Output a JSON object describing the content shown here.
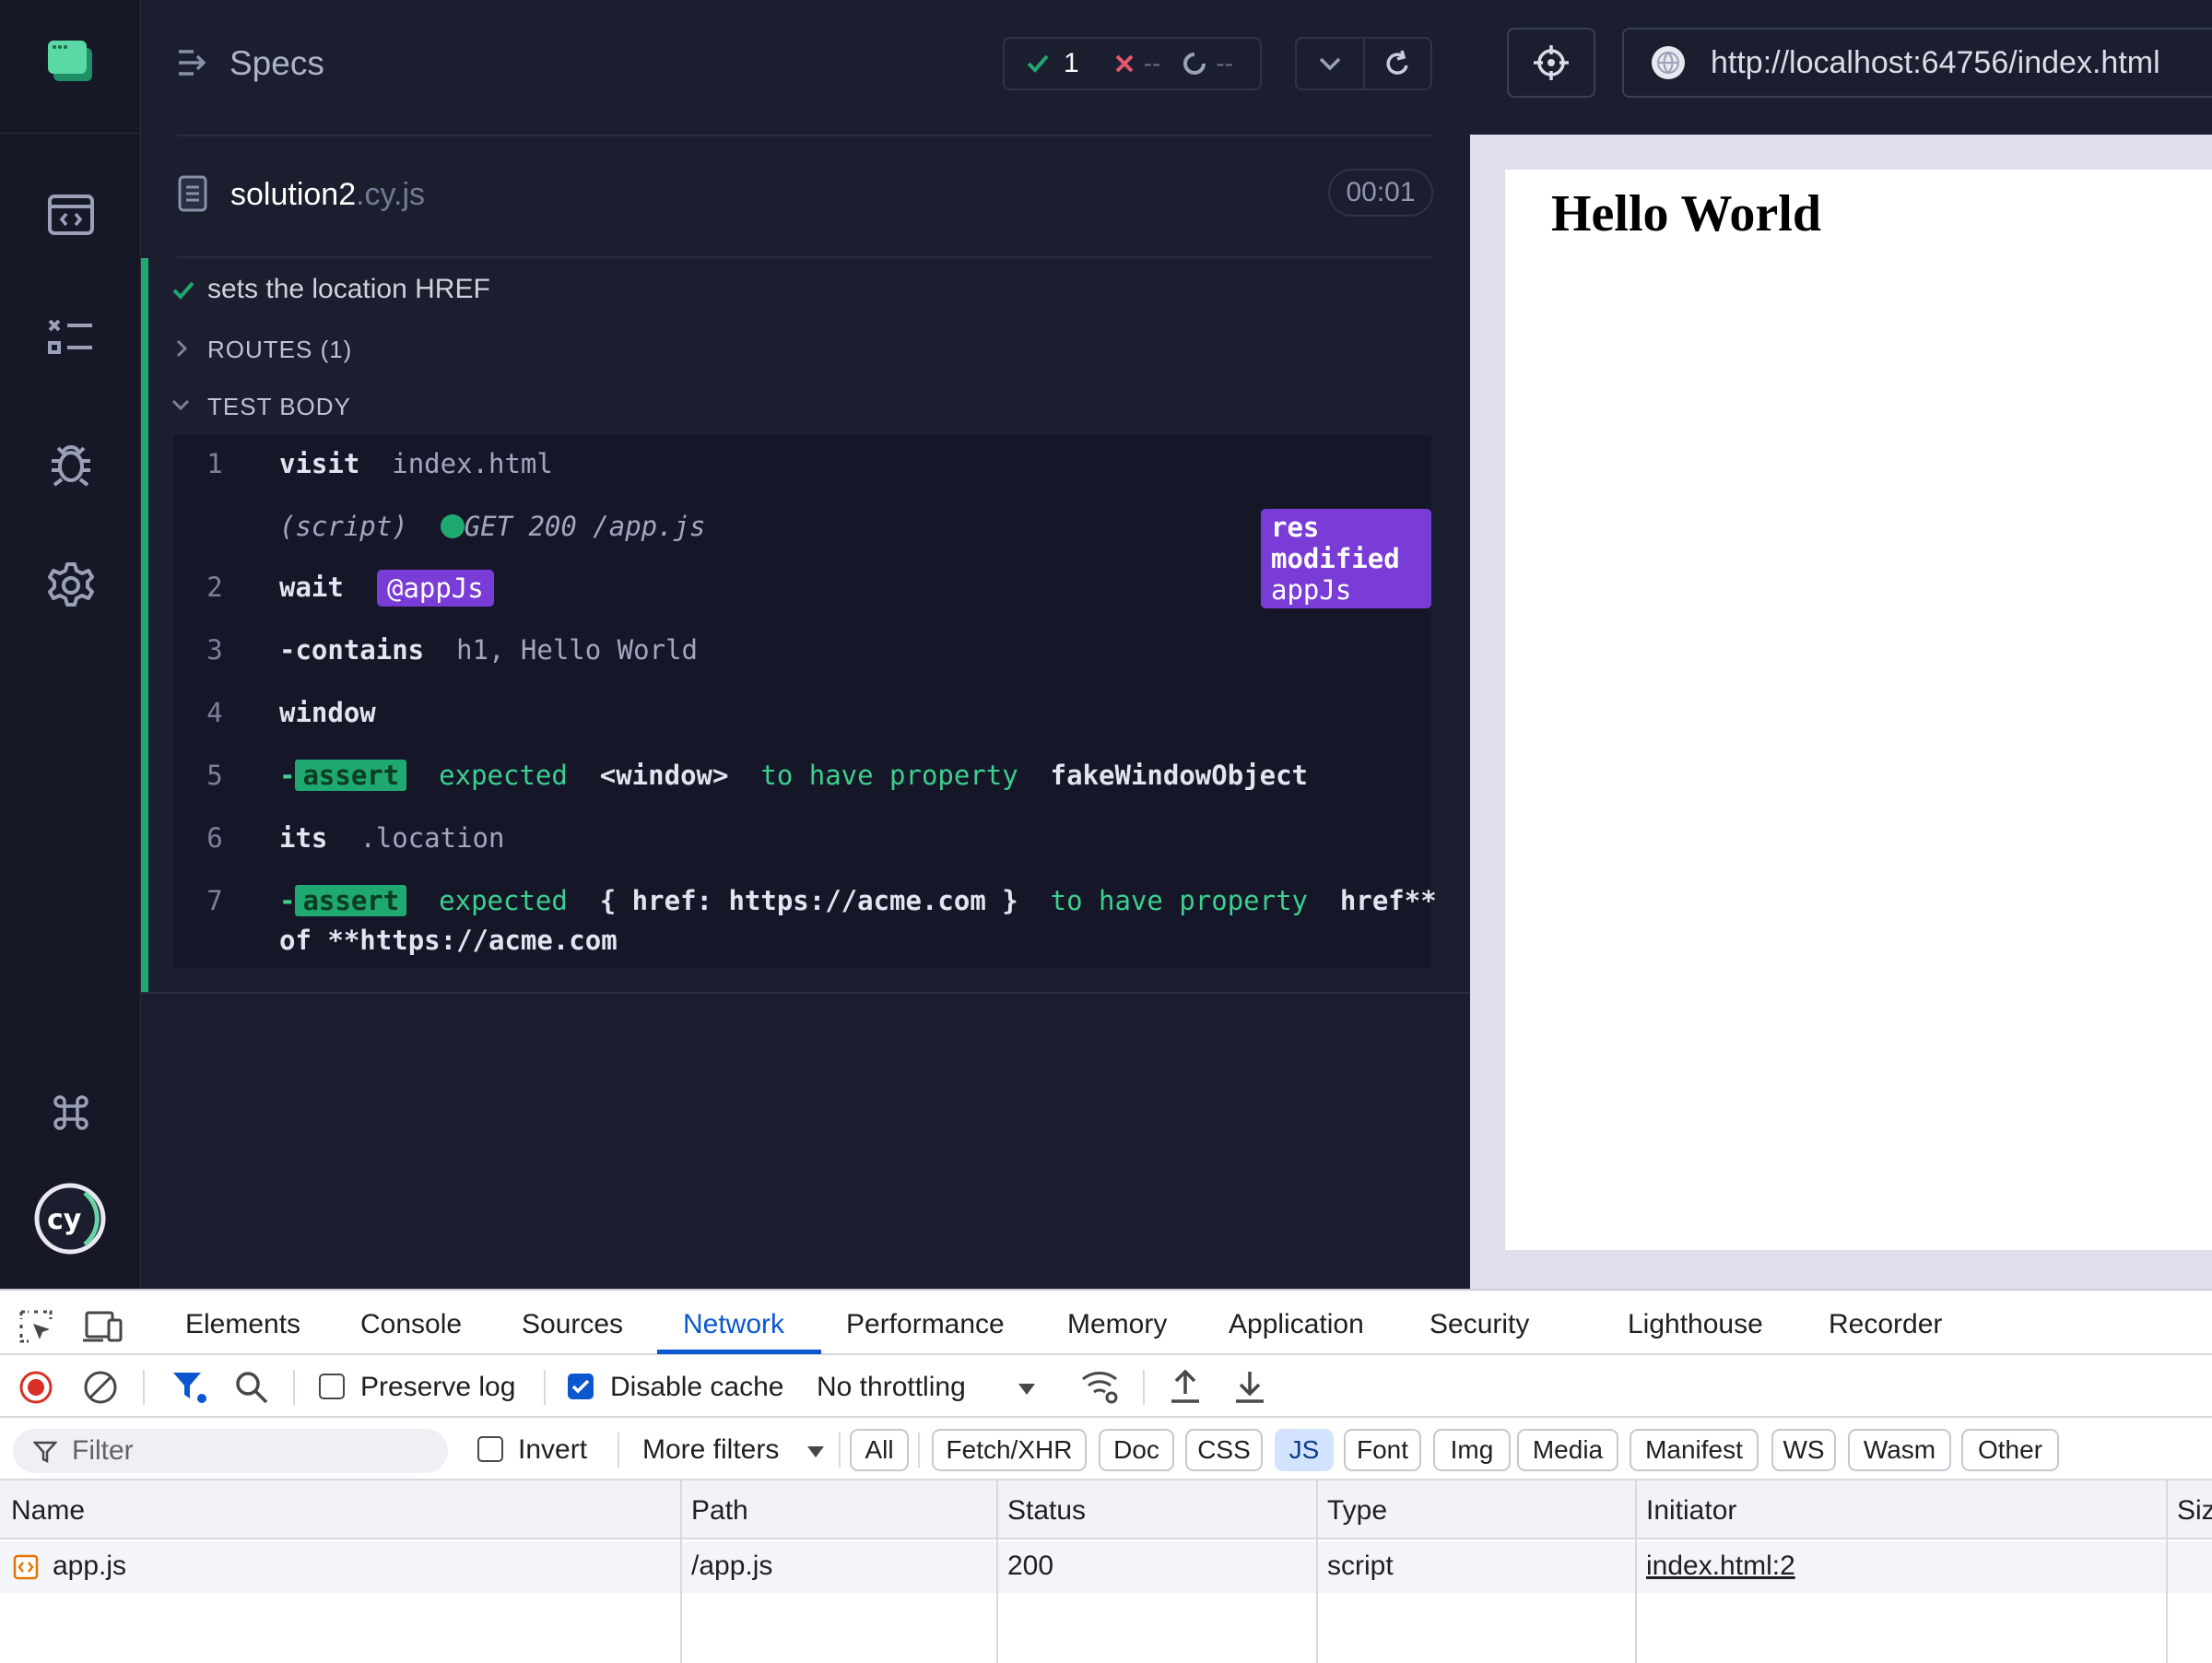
{
  "reporter": {
    "header_title": "Specs",
    "stats": {
      "passed": "1",
      "failed": "--",
      "pending": "--"
    },
    "spec": {
      "name": "solution2",
      "ext": ".cy.js",
      "duration": "00:01"
    },
    "test_title": "sets the location HREF",
    "routes_label": "ROUTES (1)",
    "test_body_label": "TEST BODY",
    "commands": [
      {
        "num": "1",
        "name": "visit",
        "arg": "index.html"
      },
      {
        "num": "",
        "name": "(script)",
        "arg": "GET 200 /app.js",
        "badge_bold": "res modified",
        "badge_alias": "appJs"
      },
      {
        "num": "2",
        "name": "wait",
        "alias": "@appJs"
      },
      {
        "num": "3",
        "name": "-contains",
        "arg": "h1, Hello World"
      },
      {
        "num": "4",
        "name": "window"
      },
      {
        "num": "5",
        "assert": "assert",
        "msg": [
          "expected",
          "<window>",
          "to have property",
          "fakeWindowObject"
        ]
      },
      {
        "num": "6",
        "name": "its",
        "arg": ".location"
      },
      {
        "num": "7",
        "assert": "assert",
        "msg": [
          "expected",
          "{ href: https://acme.com }",
          "to have property",
          "href**",
          "of",
          "**https://acme.com"
        ]
      }
    ]
  },
  "aut": {
    "url": "http://localhost:64756/index.html",
    "heading": "Hello World"
  },
  "devtools": {
    "tabs": [
      "Elements",
      "Console",
      "Sources",
      "Network",
      "Performance",
      "Memory",
      "Application",
      "Security",
      "Lighthouse",
      "Recorder"
    ],
    "active_tab": "Network",
    "preserve_log": "Preserve log",
    "disable_cache": "Disable cache",
    "throttling": "No throttling",
    "filter_placeholder": "Filter",
    "invert": "Invert",
    "more_filters": "More filters",
    "chips": [
      "All",
      "Fetch/XHR",
      "Doc",
      "CSS",
      "JS",
      "Font",
      "Img",
      "Media",
      "Manifest",
      "WS",
      "Wasm",
      "Other"
    ],
    "active_chip": "JS",
    "columns": [
      "Name",
      "Path",
      "Status",
      "Type",
      "Initiator",
      "Siz"
    ],
    "rows": [
      {
        "name": "app.js",
        "path": "/app.js",
        "status": "200",
        "type": "script",
        "initiator": "index.html:2"
      }
    ]
  }
}
